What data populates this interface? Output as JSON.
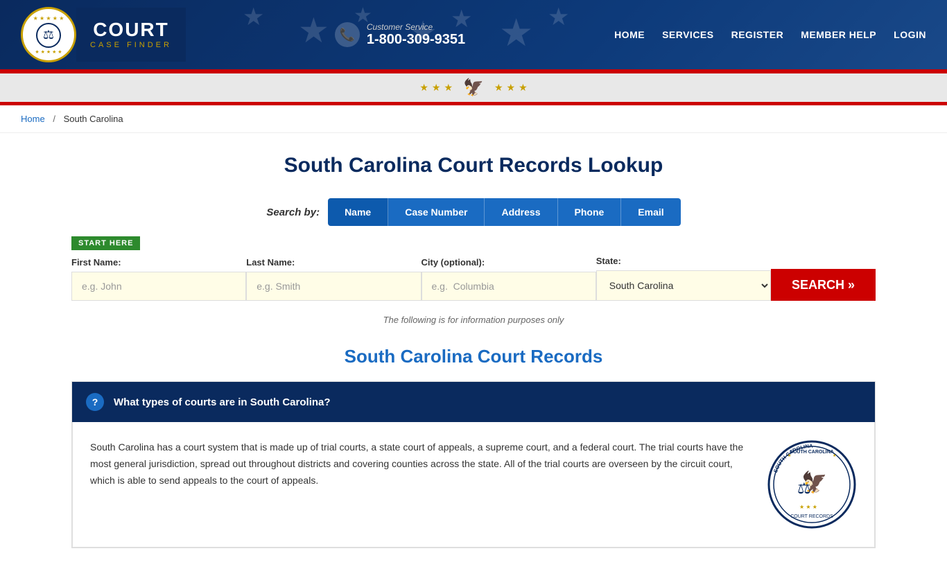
{
  "header": {
    "logo": {
      "circle_icon": "⚖",
      "court_text": "COURT",
      "case_finder_text": "CASE FINDER"
    },
    "customer_service": {
      "label": "Customer Service",
      "phone": "1-800-309-9351"
    },
    "nav": {
      "items": [
        "HOME",
        "SERVICES",
        "REGISTER",
        "MEMBER HELP",
        "LOGIN"
      ]
    }
  },
  "breadcrumb": {
    "home_label": "Home",
    "separator": "/",
    "current": "South Carolina"
  },
  "page": {
    "title": "South Carolina Court Records Lookup",
    "search_by_label": "Search by:",
    "search_tabs": [
      "Name",
      "Case Number",
      "Address",
      "Phone",
      "Email"
    ],
    "start_here": "START HERE",
    "form": {
      "first_name_label": "First Name:",
      "first_name_placeholder": "e.g. John",
      "last_name_label": "Last Name:",
      "last_name_placeholder": "e.g. Smith",
      "city_label": "City (optional):",
      "city_placeholder": "e.g.  Columbia",
      "state_label": "State:",
      "state_value": "South Carolina",
      "search_button": "SEARCH »"
    },
    "info_text": "The following is for information purposes only",
    "section_title": "South Carolina Court Records",
    "accordion": {
      "icon": "?",
      "question": "What types of courts are in South Carolina?",
      "body_text": "South Carolina has a court system that is made up of trial courts, a state court of appeals, a supreme court, and a federal court. The trial courts have the most general jurisdiction, spread out throughout districts and covering counties across the state. All of the trial courts are overseen by the circuit court, which is able to send appeals to the court of appeals."
    }
  }
}
